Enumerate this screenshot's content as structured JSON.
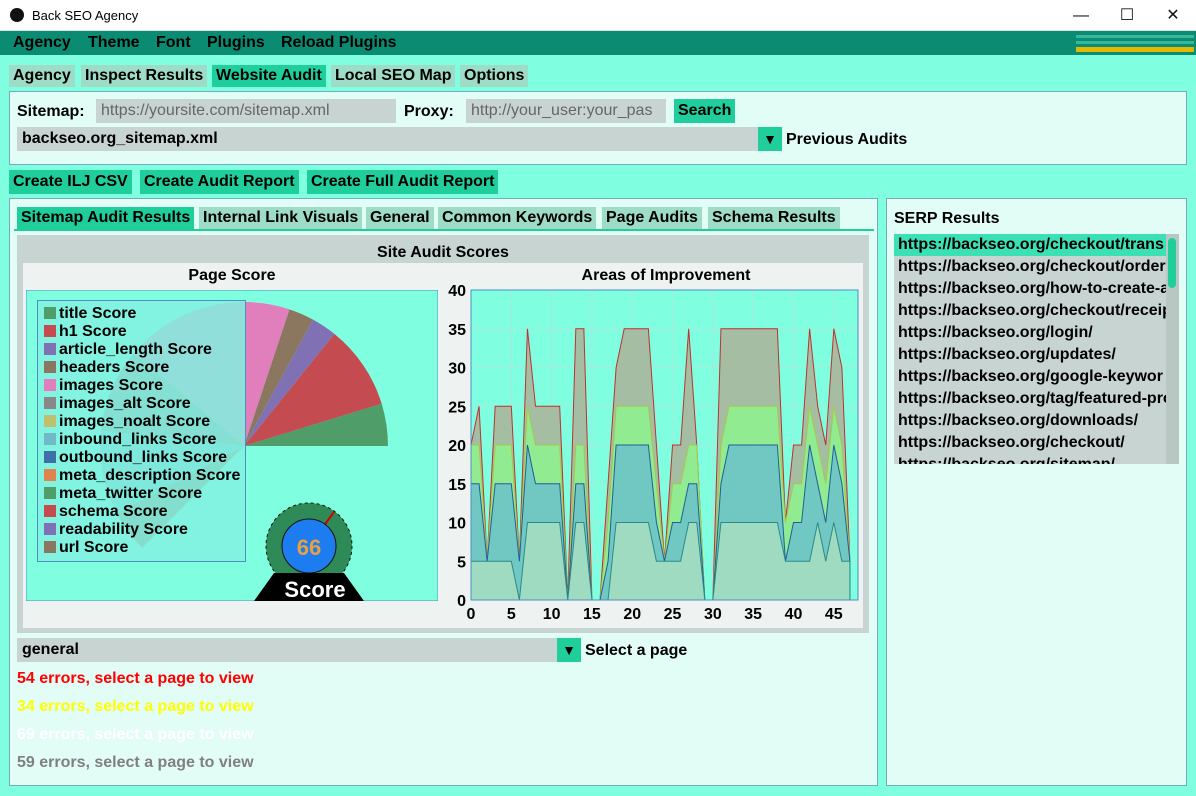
{
  "window": {
    "title": "Back SEO Agency",
    "minimize": "—",
    "maximize": "☐",
    "close": "✕"
  },
  "menu": [
    "Agency",
    "Theme",
    "Font",
    "Plugins",
    "Reload Plugins"
  ],
  "main_tabs": [
    "Agency",
    "Inspect Results",
    "Website Audit",
    "Local SEO Map",
    "Options"
  ],
  "main_tab_active": "Website Audit",
  "audit_form": {
    "sitemap_label": "Sitemap:",
    "sitemap_placeholder": "https://yoursite.com/sitemap.xml",
    "proxy_label": "Proxy:",
    "proxy_placeholder": "http://your_user:your_pas",
    "search_button": "Search",
    "previous_audit_value": "backseo.org_sitemap.xml",
    "previous_audits_label": "Previous Audits"
  },
  "actions": [
    "Create ILJ CSV",
    "Create Audit Report",
    "Create Full Audit Report"
  ],
  "sub_tabs": [
    "Sitemap Audit Results",
    "Internal Link Visuals",
    "General",
    "Common Keywords",
    "Page Audits",
    "Schema Results"
  ],
  "sub_tab_active": "Sitemap Audit Results",
  "figure_title": "Site Audit Scores",
  "gauge": {
    "value": "66",
    "label": "Score"
  },
  "chart_data": [
    {
      "type": "pie",
      "title": "Page Score",
      "legend_placement": "top-left",
      "series": [
        {
          "name": "title Score",
          "color": "#4f9e6a",
          "value": 5
        },
        {
          "name": "h1 Score",
          "color": "#c44b50",
          "value": 10
        },
        {
          "name": "article_length Score",
          "color": "#8071b5",
          "value": 3
        },
        {
          "name": "headers Score",
          "color": "#8b7760",
          "value": 3
        },
        {
          "name": "images Score",
          "color": "#e07fbc",
          "value": 20
        },
        {
          "name": "images_alt Score",
          "color": "#888888",
          "value": 10
        },
        {
          "name": "images_noalt Score",
          "color": "#bfbf6f",
          "value": 0
        },
        {
          "name": "inbound_links Score",
          "color": "#6fb9c9",
          "value": 10
        },
        {
          "name": "outbound_links Score",
          "color": "#3f6fa8",
          "value": 0
        },
        {
          "name": "meta_description Score",
          "color": "#e0844f",
          "value": 0
        },
        {
          "name": "meta_twitter Score",
          "color": "#4f9e6a",
          "value": 0
        },
        {
          "name": "schema Score",
          "color": "#c44b50",
          "value": 0
        },
        {
          "name": "readability Score",
          "color": "#8071b5",
          "value": 0
        },
        {
          "name": "url Score",
          "color": "#8b7760",
          "value": 5
        }
      ]
    },
    {
      "type": "area",
      "title": "Areas of Improvement",
      "xlim": [
        0,
        48
      ],
      "ylim": [
        0,
        40
      ],
      "xticks": [
        0,
        5,
        10,
        15,
        20,
        25,
        30,
        35,
        40,
        45
      ],
      "yticks": [
        0,
        5,
        10,
        15,
        20,
        25,
        30,
        35,
        40
      ],
      "grid": true,
      "series": [
        {
          "name": "",
          "color": "#a3ddc0",
          "values": [
            5,
            5,
            5,
            5,
            5,
            5,
            0,
            10,
            10,
            10,
            10,
            10,
            0,
            10,
            10,
            0,
            0,
            0,
            10,
            10,
            10,
            10,
            10,
            5,
            5,
            5,
            5,
            10,
            10,
            0,
            0,
            10,
            10,
            10,
            10,
            10,
            10,
            10,
            10,
            5,
            5,
            5,
            5,
            10,
            5,
            10,
            5,
            5
          ]
        },
        {
          "name": "",
          "color": "#6ec3c8",
          "values": [
            15,
            15,
            5,
            15,
            15,
            15,
            5,
            20,
            15,
            15,
            15,
            15,
            0,
            15,
            15,
            0,
            0,
            5,
            20,
            20,
            20,
            20,
            20,
            10,
            5,
            10,
            10,
            15,
            15,
            0,
            0,
            15,
            20,
            20,
            20,
            20,
            20,
            20,
            20,
            5,
            10,
            10,
            20,
            15,
            10,
            20,
            15,
            5
          ]
        },
        {
          "name": "",
          "color": "#8ef08f",
          "values": [
            20,
            20,
            5,
            20,
            20,
            20,
            5,
            25,
            20,
            20,
            20,
            20,
            0,
            20,
            20,
            0,
            0,
            10,
            25,
            25,
            25,
            25,
            25,
            15,
            5,
            15,
            15,
            20,
            20,
            0,
            0,
            20,
            25,
            25,
            25,
            25,
            25,
            25,
            25,
            10,
            15,
            15,
            25,
            20,
            15,
            25,
            20,
            5
          ]
        },
        {
          "name": "",
          "color": "#a9b69c",
          "values": [
            20,
            25,
            5,
            25,
            25,
            25,
            5,
            35,
            25,
            25,
            25,
            25,
            0,
            35,
            35,
            0,
            0,
            15,
            30,
            35,
            35,
            35,
            35,
            20,
            5,
            20,
            20,
            35,
            20,
            0,
            0,
            35,
            35,
            35,
            35,
            35,
            35,
            35,
            35,
            10,
            20,
            20,
            35,
            25,
            20,
            35,
            30,
            5
          ]
        }
      ]
    }
  ],
  "page_select": {
    "value": "general",
    "label": "Select a page"
  },
  "errors": [
    {
      "text": "54 errors, select a page to view",
      "color": "#ff0000"
    },
    {
      "text": "34 errors, select a page to view",
      "color": "#ffff00"
    },
    {
      "text": "69 errors, select a page to view",
      "color": "#ffffff"
    },
    {
      "text": "59 errors, select a page to view",
      "color": "#808080"
    }
  ],
  "serp": {
    "title": "SERP Results",
    "items": [
      "https://backseo.org/checkout/trans",
      "https://backseo.org/checkout/order",
      "https://backseo.org/how-to-create-a",
      "https://backseo.org/checkout/receip",
      "https://backseo.org/login/",
      "https://backseo.org/updates/",
      "https://backseo.org/google-keywor",
      "https://backseo.org/tag/featured-pro",
      "https://backseo.org/downloads/",
      "https://backseo.org/checkout/",
      "https://backseo.org/sitemap/"
    ]
  }
}
